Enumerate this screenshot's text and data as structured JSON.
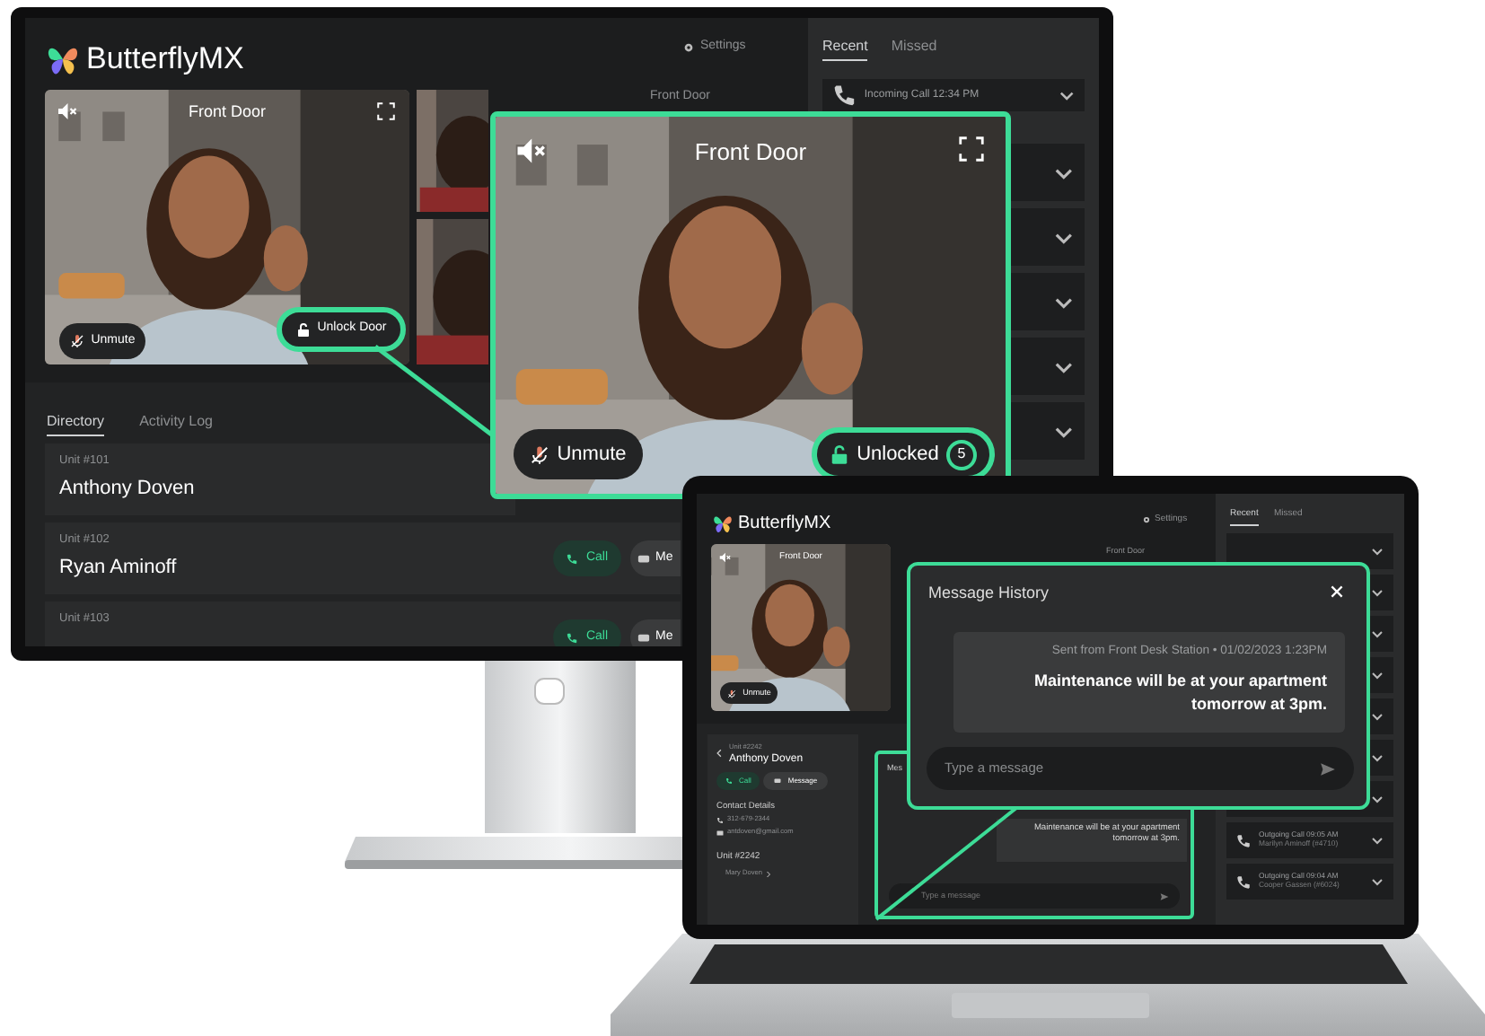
{
  "monitor": {
    "logo": "ButterflyMX",
    "settings": "Settings",
    "side_label": "Front Door",
    "video": {
      "title": "Front Door",
      "unmute": "Unmute",
      "unlock": "Unlock Door"
    },
    "call_tabs": [
      {
        "label": "Recent",
        "selected": true
      },
      {
        "label": "Missed",
        "selected": false
      }
    ],
    "calls": [
      {
        "label": "Incoming Call 12:34 PM",
        "expanded": false
      },
      {
        "expanded": false
      },
      {
        "expanded": false
      },
      {
        "expanded": false
      },
      {
        "expanded": false
      },
      {
        "expanded": false
      }
    ],
    "tabs": [
      {
        "label": "Directory",
        "selected": true
      },
      {
        "label": "Activity Log",
        "selected": false
      }
    ],
    "directory": [
      {
        "unit": "Unit #101",
        "name": "Anthony Doven"
      },
      {
        "unit": "Unit #102",
        "name": "Ryan Aminoff",
        "call": "Call",
        "message": "Me"
      },
      {
        "unit": "Unit #103",
        "call": "Call",
        "message": "Me"
      }
    ]
  },
  "callout": {
    "title": "Front Door",
    "unmute": "Unmute",
    "unlock": "Unlocked",
    "countdown": "5"
  },
  "laptop": {
    "logo": "ButterflyMX",
    "settings": "Settings",
    "side_label": "Front Door",
    "video": {
      "title": "Front Door",
      "unmute": "Unmute"
    },
    "call_tabs": [
      {
        "label": "Recent",
        "selected": true
      },
      {
        "label": "Missed",
        "selected": false
      }
    ],
    "calls": [
      {
        "expanded": false
      },
      {
        "expanded": false
      },
      {
        "expanded": false
      },
      {
        "expanded": false
      },
      {
        "expanded": false
      },
      {
        "expanded": false
      },
      {
        "expanded": false
      },
      {
        "label": "Outgoing Call 09:05 AM",
        "sub": "Marilyn Aminoff (#4710)",
        "expanded": false
      },
      {
        "label": "Outgoing Call 09:04 AM",
        "sub": "Cooper Gassen (#6024)",
        "expanded": false
      }
    ],
    "contact": {
      "unit": "Unit #2242",
      "name": "Anthony Doven",
      "call": "Call",
      "message": "Message",
      "details_title": "Contact Details",
      "phone": "312-679-2344",
      "email": "antdoven@gmail.com",
      "unit_title": "Unit #2242",
      "member": "Mary Doven"
    },
    "thread": {
      "title": "Mes",
      "message": "Maintenance will be at your apartment tomorrow at 3pm.",
      "placeholder": "Type a message"
    },
    "history": {
      "title": "Message History",
      "meta": "Sent from Front Desk Station • 01/02/2023  1:23PM",
      "message": "Maintenance will be at your apartment tomorrow at 3pm.",
      "placeholder": "Type a message"
    }
  }
}
